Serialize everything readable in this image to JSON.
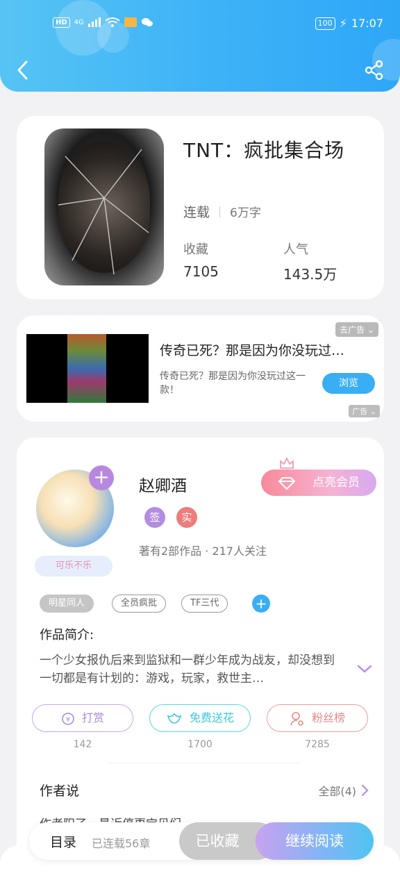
{
  "status_bar": {
    "left": [
      "HD",
      "4G"
    ],
    "battery": "100",
    "time": "17:07"
  },
  "book": {
    "title": "TNT：疯批集合场",
    "status": "连载",
    "words": "6万字",
    "collect_label": "收藏",
    "collect_value": "7105",
    "popularity_label": "人气",
    "popularity_value": "143.5万"
  },
  "ad": {
    "close_label": "去广告",
    "title": "传奇已死？那是因为你没玩过…",
    "desc": "传奇已死？那是因为你没玩过这一款！",
    "button": "浏览",
    "mark": "广告"
  },
  "author": {
    "name": "赵卿酒",
    "avatar_tag": "可乐不乐",
    "vip_button": "点亮会员",
    "badges": [
      "签",
      "实"
    ],
    "works": "著有2部作品 · 217人关注"
  },
  "tags": [
    "明星同人",
    "全员疯批",
    "TF三代"
  ],
  "intro": {
    "label": "作品简介:",
    "text": "一个少女报仇后来到监狱和一群少年成为战友，却没想到一切都是有计划的：游戏，玩家，救世主…"
  },
  "actions": [
    {
      "label": "打赏",
      "count": "142"
    },
    {
      "label": "免费送花",
      "count": "1700"
    },
    {
      "label": "粉丝榜",
      "count": "7285"
    }
  ],
  "author_say": {
    "title": "作者说",
    "all": "全部(4)",
    "preview": "作者阳了，最近停更宝贝们"
  },
  "bottom": {
    "toc": "目录",
    "toc_status": "已连载56章",
    "collected": "已收藏",
    "continue": "继续阅读"
  },
  "colors": {
    "header": "#3fb3f7",
    "accent_blue": "#3aaef5",
    "purple": "#b888e0",
    "pink": "#ee7c7c"
  },
  "icons": [
    "back-icon",
    "share-icon",
    "plus-icon",
    "crown-icon",
    "diamond-icon",
    "chevron-down-icon",
    "chevron-right-icon",
    "coin-icon",
    "flower-icon",
    "fans-icon"
  ]
}
